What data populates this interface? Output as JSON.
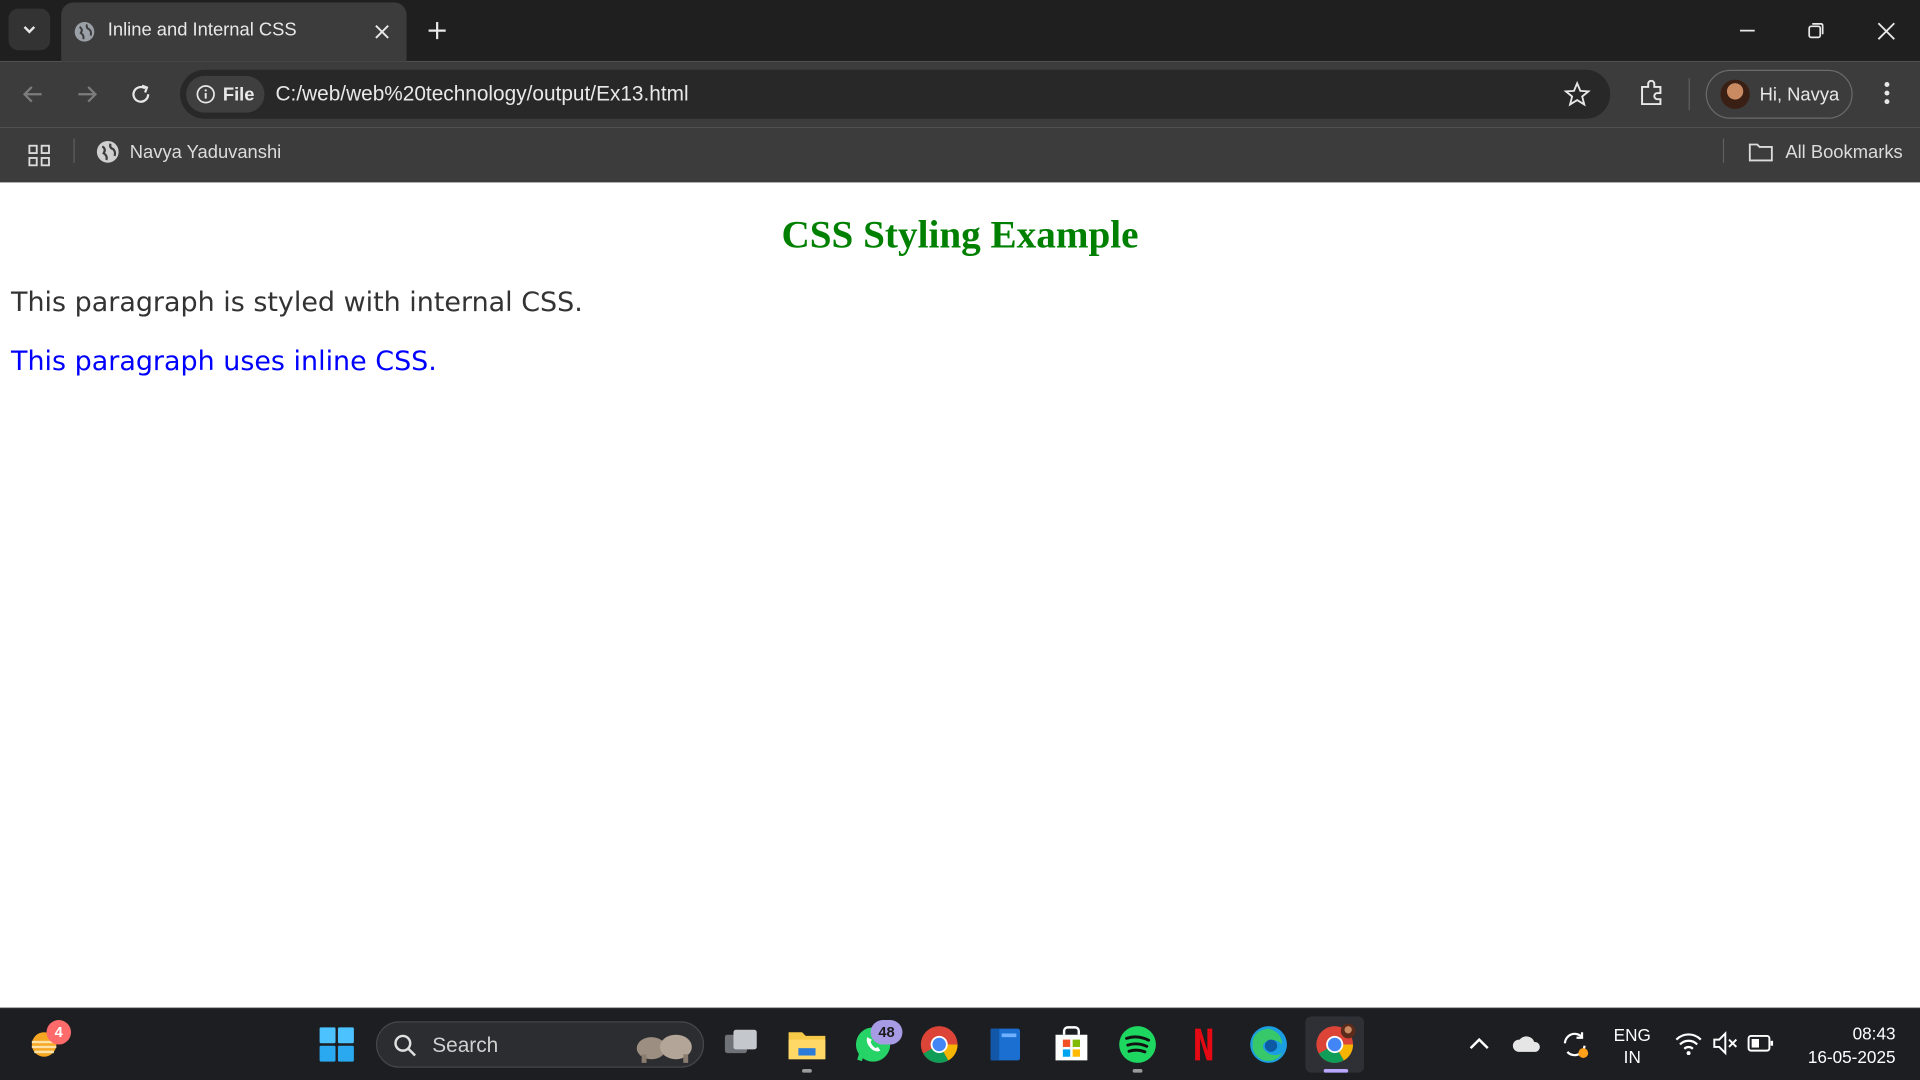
{
  "browser": {
    "tab_title": "Inline and Internal CSS",
    "chip_label": "File",
    "url": "C:/web/web%20technology/output/Ex13.html",
    "profile_name": "Hi, Navya",
    "bookmark_item": "Navya Yaduvanshi",
    "all_bookmarks": "All Bookmarks"
  },
  "page": {
    "heading": "CSS Styling Example",
    "paragraph_internal": "This paragraph is styled with internal CSS.",
    "paragraph_inline": "This paragraph uses inline CSS.",
    "heading_color": "#008000",
    "inline_color": "#0000ff"
  },
  "taskbar": {
    "weather_badge": "4",
    "search_label": "Search",
    "whatsapp_badge": "48",
    "lang_line1": "ENG",
    "lang_line2": "IN",
    "time": "08:43",
    "date": "16-05-2025"
  },
  "icons": [
    "tab-list-icon",
    "globe-icon",
    "close-icon",
    "plus-icon",
    "minimize-icon",
    "restore-icon",
    "back-arrow-icon",
    "forward-arrow-icon",
    "reload-icon",
    "info-icon",
    "star-icon",
    "extensions-icon",
    "more-vert-icon",
    "apps-grid-icon",
    "folder-icon",
    "weather-icon",
    "windows-start-icon",
    "search-icon",
    "task-view-icon",
    "file-explorer-icon",
    "whatsapp-icon",
    "chrome-icon",
    "app-icon",
    "store-icon",
    "spotify-icon",
    "netflix-icon",
    "edge-icon",
    "chevron-up-icon",
    "onedrive-icon",
    "sync-icon",
    "wifi-icon",
    "mute-icon",
    "battery-icon"
  ]
}
